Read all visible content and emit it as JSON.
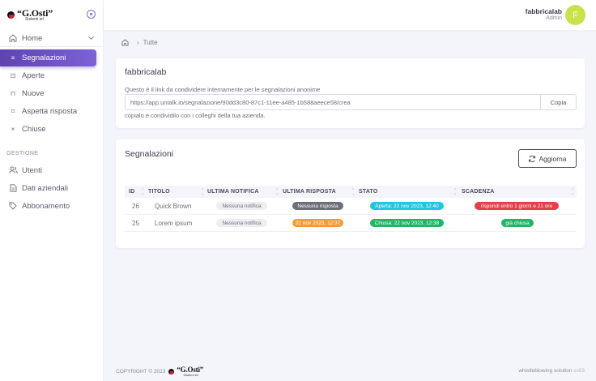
{
  "brand": {
    "name": "G.Osti",
    "sub": "Sistemi srl"
  },
  "sidebar": {
    "home_label": "Home",
    "active_label": "Segnalazioni",
    "sub_items": [
      {
        "label": "Aperte"
      },
      {
        "label": "Nuove"
      },
      {
        "label": "Aspetta risposta"
      },
      {
        "label": "Chiuse"
      }
    ],
    "section_label": "GESTIONE",
    "manage_items": [
      {
        "label": "Utenti"
      },
      {
        "label": "Dati aziendali"
      },
      {
        "label": "Abbonamento"
      }
    ]
  },
  "topbar": {
    "user_name": "fabbricalab",
    "user_role": "Admin",
    "avatar_initial": "F",
    "avatar_color": "#c9e24a"
  },
  "breadcrumb": {
    "current": "Tutte"
  },
  "share_card": {
    "title": "fabbricalab",
    "description": "Questo è il link da condividere internamente per le segnalazioni anonime",
    "link": "https://app.untalk.io/segnalazione/90dd3c80-87c1-11ee-a485-1b588aeece58/crea",
    "copy_label": "Copia",
    "note": "copialo e condividilo con i colleghi della tua azienda."
  },
  "reports_card": {
    "title": "Segnalazioni",
    "refresh_label": "Aggiorna",
    "columns": [
      "ID",
      "TITOLO",
      "ULTIMA NOTIFICA",
      "ULTIMA RISPOSTA",
      "STATO",
      "SCADENZA"
    ],
    "rows": [
      {
        "id": "26",
        "title": "Quick Brown",
        "last_notification": "Nessuna notifica",
        "last_reply": "Nessuna risposta",
        "status": "Aperta: 22 nov 2023, 12:40",
        "deadline": "rispondi entro 1 giorni e 21 ore"
      },
      {
        "id": "25",
        "title": "Lorem ipsum",
        "last_notification": "Nessuna notifica",
        "last_reply": "22 nov 2023, 12:37",
        "status": "Chiusa: 22 nov 2023, 12:38",
        "deadline": "già chiusa"
      }
    ]
  },
  "footer": {
    "copyright": "COPYRIGHT © 2023",
    "right_text": "whistleblowing solution",
    "version": "cs03"
  },
  "colors": {
    "accent": "#6a4fc4",
    "cyan": "#1ec6e6",
    "green": "#21b565",
    "red": "#e43f4a",
    "orange": "#f59a3a",
    "gray": "#6c6f78"
  }
}
